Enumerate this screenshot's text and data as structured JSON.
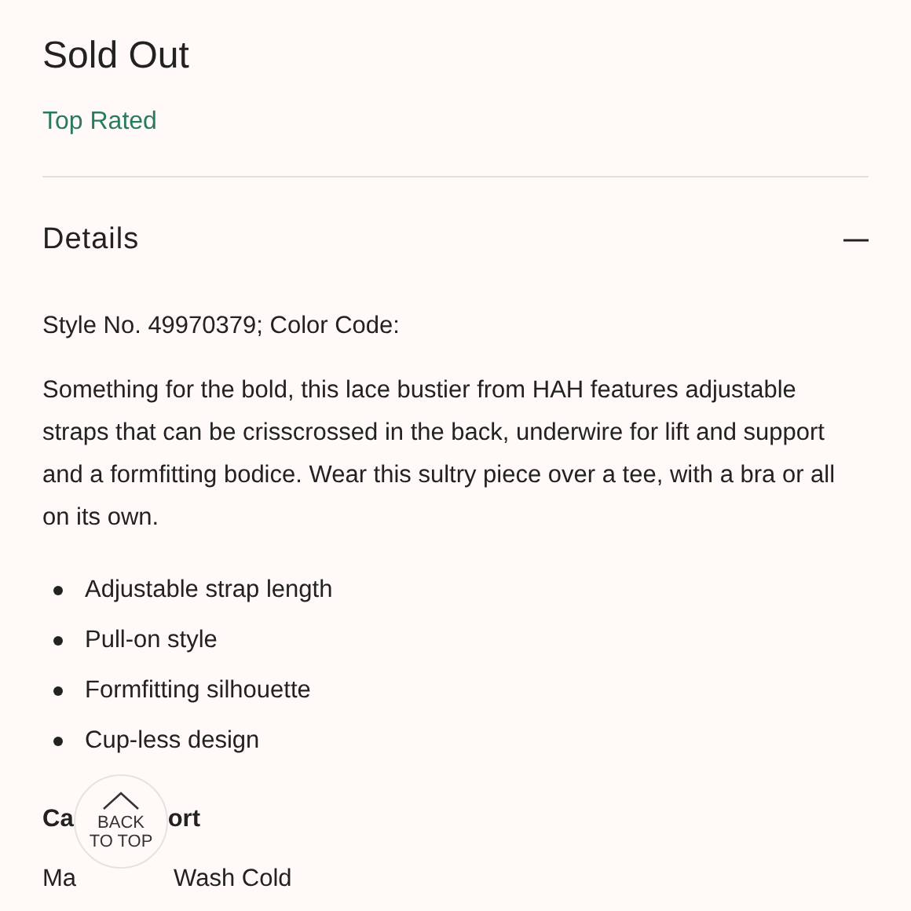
{
  "status": "Sold Out",
  "badge": "Top Rated",
  "details": {
    "title": "Details",
    "expanded": true,
    "style_line": "Style No. 49970379; Color Code:",
    "description": "Something for the bold, this lace bustier from HAH features adjustable straps that can be crisscrossed in the back, underwire for lift and support and a formfitting bodice. Wear this sultry piece over a tee, with a bra or all on its own.",
    "features": [
      "Adjustable strap length",
      "Pull-on style",
      "Formfitting silhouette",
      "Cup-less design"
    ],
    "care_heading": [
      "Ca",
      "ort"
    ],
    "care_text": [
      "Ma",
      "Wash Cold"
    ]
  },
  "back_to_top": [
    "BACK",
    "TO TOP"
  ]
}
